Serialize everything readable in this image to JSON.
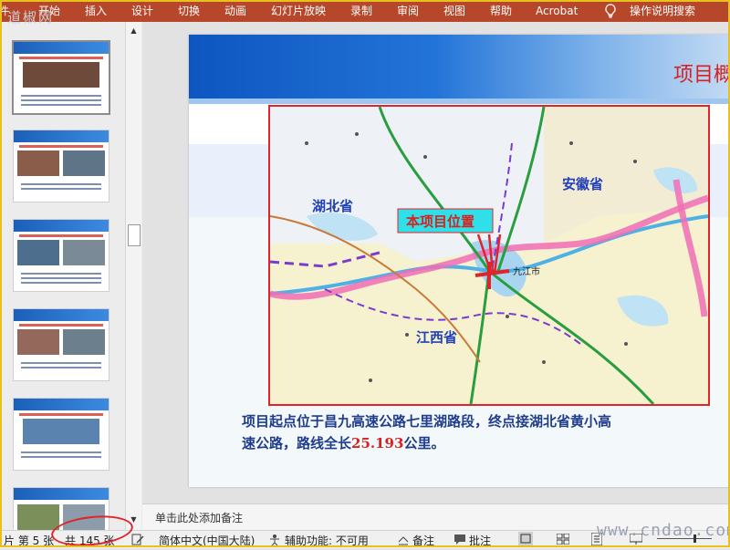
{
  "watermark_logo": "道椒网",
  "ribbon": {
    "tabs": [
      "件",
      "开始",
      "插入",
      "设计",
      "切换",
      "动画",
      "幻灯片放映",
      "录制",
      "审阅",
      "视图",
      "帮助",
      "Acrobat"
    ],
    "tell_me": "操作说明搜索",
    "icon": "lightbulb-icon"
  },
  "thumbnail_pane": {
    "scroll_up": "▲",
    "scroll_down": "▼"
  },
  "slide": {
    "title": "项目概",
    "map_labels": {
      "hubei": "湖北省",
      "anhui": "安徽省",
      "jiangxi": "江西省",
      "project_location": "本项目位置",
      "jiujiang": "九江市"
    },
    "body_line1": "项目起点位于昌九高速公路七里湖路段，终点接湖北省黄小高",
    "body_line2_prefix": "速公路，路线全长",
    "body_length": "25.193",
    "body_line2_suffix": "公里。"
  },
  "notes": {
    "placeholder": "单击此处添加备注"
  },
  "status_bar": {
    "slide_label": "片 第 5 张",
    "slide_total": "共 145 张",
    "language": "简体中文(中国大陆)",
    "accessibility": "辅助功能: 不可用",
    "notes_button": "备注",
    "comments_button": "批注"
  },
  "colors": {
    "ribbon": "#b7472a",
    "accent_red": "#d8201e",
    "text_blue": "#1f3d8a"
  },
  "brand_watermark": "www.cndao.com"
}
